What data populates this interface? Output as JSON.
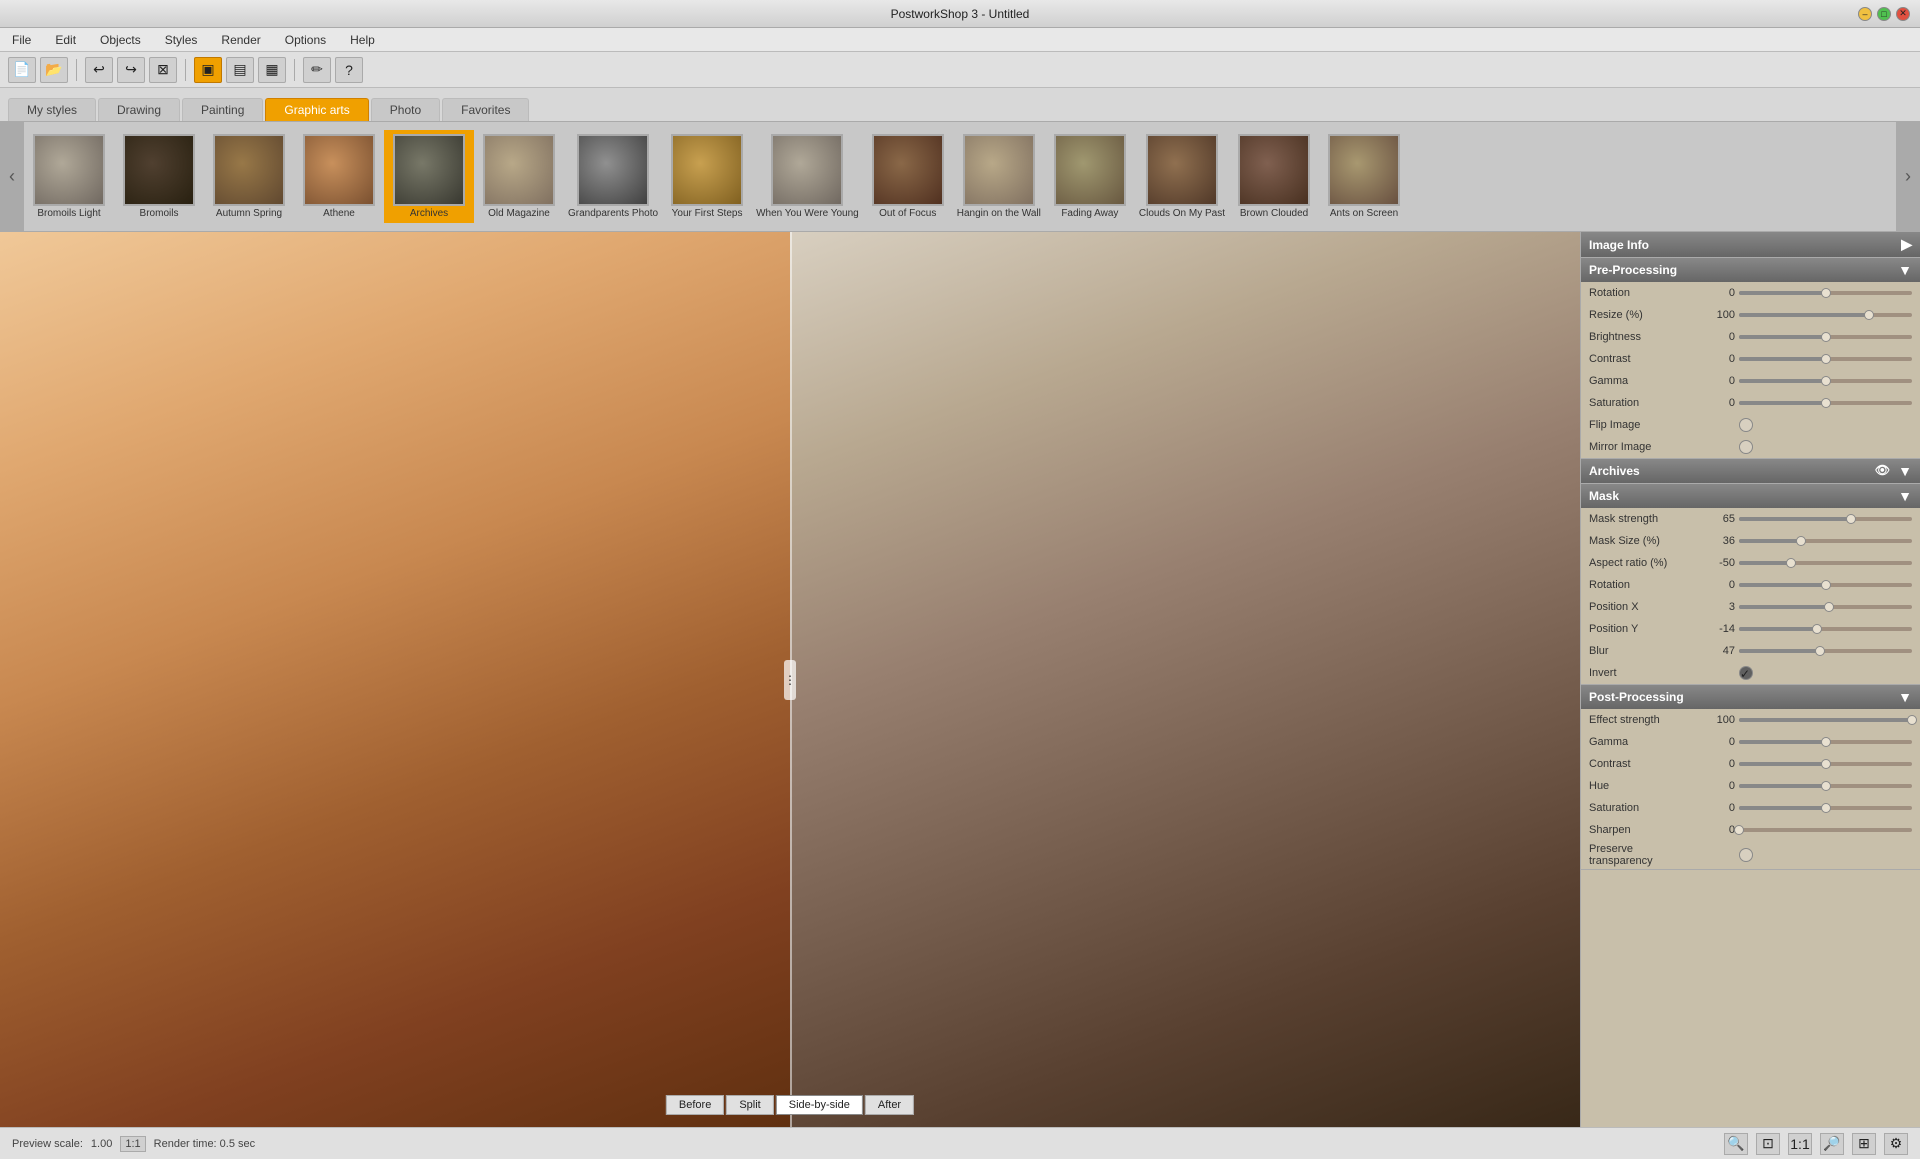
{
  "app": {
    "title": "PostworkShop 3 - Untitled",
    "win_controls": [
      "–",
      "□",
      "✕"
    ]
  },
  "menu": {
    "items": [
      "File",
      "Edit",
      "Objects",
      "Styles",
      "Render",
      "Options",
      "Help"
    ]
  },
  "toolbar": {
    "buttons": [
      "💾",
      "📂",
      "↩",
      "↪",
      "⊠",
      "▣",
      "▤",
      "▦",
      "✏",
      "?"
    ]
  },
  "style_tabs": {
    "tabs": [
      "My styles",
      "Drawing",
      "Painting",
      "Graphic arts",
      "Photo",
      "Favorites"
    ],
    "active": "Graphic arts"
  },
  "filter_strip": {
    "items": [
      {
        "label": "Bromoils Light",
        "style": "thumb-face-fog"
      },
      {
        "label": "Bromoils",
        "style": "thumb-face-dark"
      },
      {
        "label": "Autumn Spring",
        "style": "thumb-face-sepia"
      },
      {
        "label": "Athene",
        "style": "thumb-face-warm"
      },
      {
        "label": "Archives",
        "style": "thumb-face-archive",
        "active": true
      },
      {
        "label": "Old Magazine",
        "style": "thumb-face-light"
      },
      {
        "label": "Grandparents Photo",
        "style": "thumb-face-bw"
      },
      {
        "label": "Your First Steps",
        "style": "thumb-face-gold"
      },
      {
        "label": "When You Were Young",
        "style": "thumb-face-fog"
      },
      {
        "label": "Out of Focus",
        "style": "thumb-face-brown"
      },
      {
        "label": "Hangin on the Wall",
        "style": "thumb-face-light"
      },
      {
        "label": "Fading Away",
        "style": "thumb-face-fade"
      },
      {
        "label": "Clouds On My Past",
        "style": "thumb-face-cloud"
      },
      {
        "label": "Brown Clouded",
        "style": "thumb-face-clouded"
      },
      {
        "label": "Ants on Screen",
        "style": "thumb-face-ants"
      }
    ]
  },
  "canvas": {
    "view_buttons": [
      "Before",
      "Split",
      "Side-by-side",
      "After"
    ],
    "active_view": "Split"
  },
  "right_panel": {
    "image_info": {
      "header": "Image Info",
      "collapsed": false
    },
    "pre_processing": {
      "header": "Pre-Processing",
      "fields": [
        {
          "label": "Rotation",
          "value": "0",
          "percent": 50
        },
        {
          "label": "Resize (%)",
          "value": "100",
          "percent": 75
        },
        {
          "label": "Brightness",
          "value": "0",
          "percent": 50
        },
        {
          "label": "Contrast",
          "value": "0",
          "percent": 50
        },
        {
          "label": "Gamma",
          "value": "0",
          "percent": 50
        },
        {
          "label": "Saturation",
          "value": "0",
          "percent": 50
        }
      ],
      "flip_image": {
        "label": "Flip Image",
        "checked": false
      },
      "mirror_image": {
        "label": "Mirror Image",
        "checked": false
      }
    },
    "archives": {
      "header": "Archives"
    },
    "mask": {
      "header": "Mask",
      "fields": [
        {
          "label": "Mask strength",
          "value": "65",
          "percent": 65
        },
        {
          "label": "Mask Size (%)",
          "value": "36",
          "percent": 36
        },
        {
          "label": "Aspect ratio (%)",
          "value": "-50",
          "percent": 30
        },
        {
          "label": "Rotation",
          "value": "0",
          "percent": 50
        },
        {
          "label": "Position X",
          "value": "3",
          "percent": 52
        },
        {
          "label": "Position Y",
          "value": "-14",
          "percent": 45
        },
        {
          "label": "Blur",
          "value": "47",
          "percent": 47
        }
      ],
      "invert": {
        "label": "Invert",
        "checked": true
      }
    },
    "post_processing": {
      "header": "Post-Processing",
      "fields": [
        {
          "label": "Effect strength",
          "value": "100",
          "percent": 100
        },
        {
          "label": "Gamma",
          "value": "0",
          "percent": 50
        },
        {
          "label": "Contrast",
          "value": "0",
          "percent": 50
        },
        {
          "label": "Hue",
          "value": "0",
          "percent": 50
        },
        {
          "label": "Saturation",
          "value": "0",
          "percent": 50
        },
        {
          "label": "Sharpen",
          "value": "0",
          "percent": 0
        }
      ],
      "preserve_transparency": {
        "label": "Preserve transparency",
        "checked": false
      }
    }
  },
  "statusbar": {
    "preview_label": "Preview scale:",
    "preview_scale": "1.00",
    "ratio": "1:1",
    "render_label": "Render time: 0.5 sec"
  }
}
